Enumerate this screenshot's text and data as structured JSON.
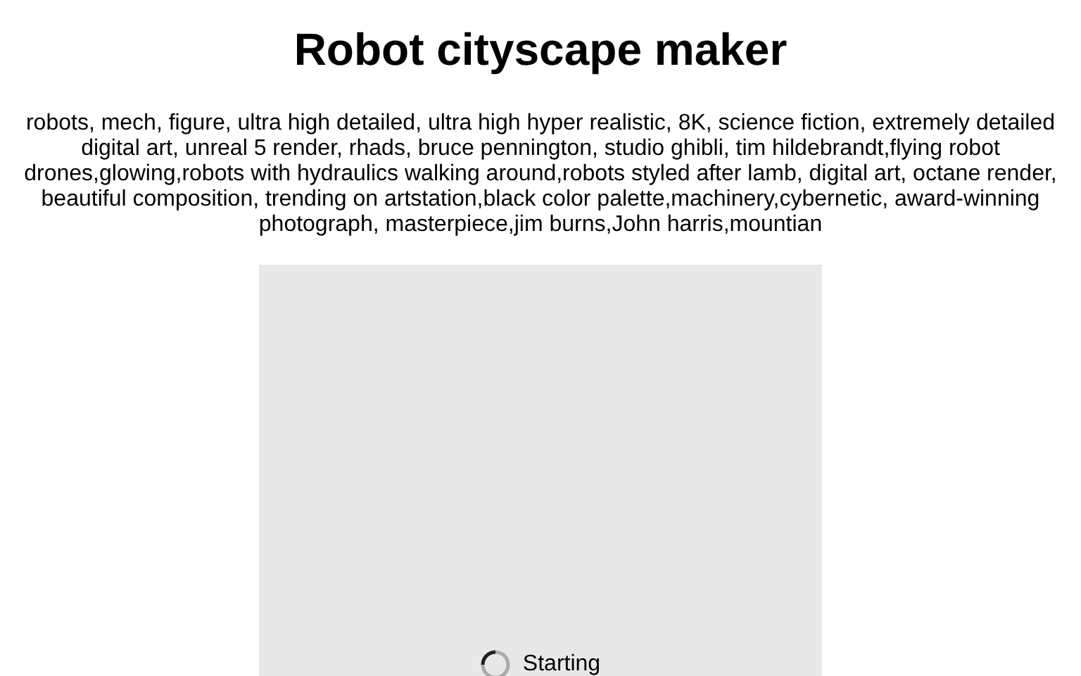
{
  "title": "Robot cityscape maker",
  "prompt": "robots, mech, figure, ultra high detailed, ultra high hyper realistic, 8K, science fiction, extremely detailed digital art, unreal 5 render, rhads, bruce pennington, studio ghibli, tim hildebrandt,flying robot drones,glowing,robots with hydraulics walking around,robots styled after lamb, digital art, octane render, beautiful composition, trending on artstation,black color palette,machinery,cybernetic, award-winning photograph, masterpiece,jim burns,John harris,mountian",
  "output": {
    "status": "Starting"
  }
}
